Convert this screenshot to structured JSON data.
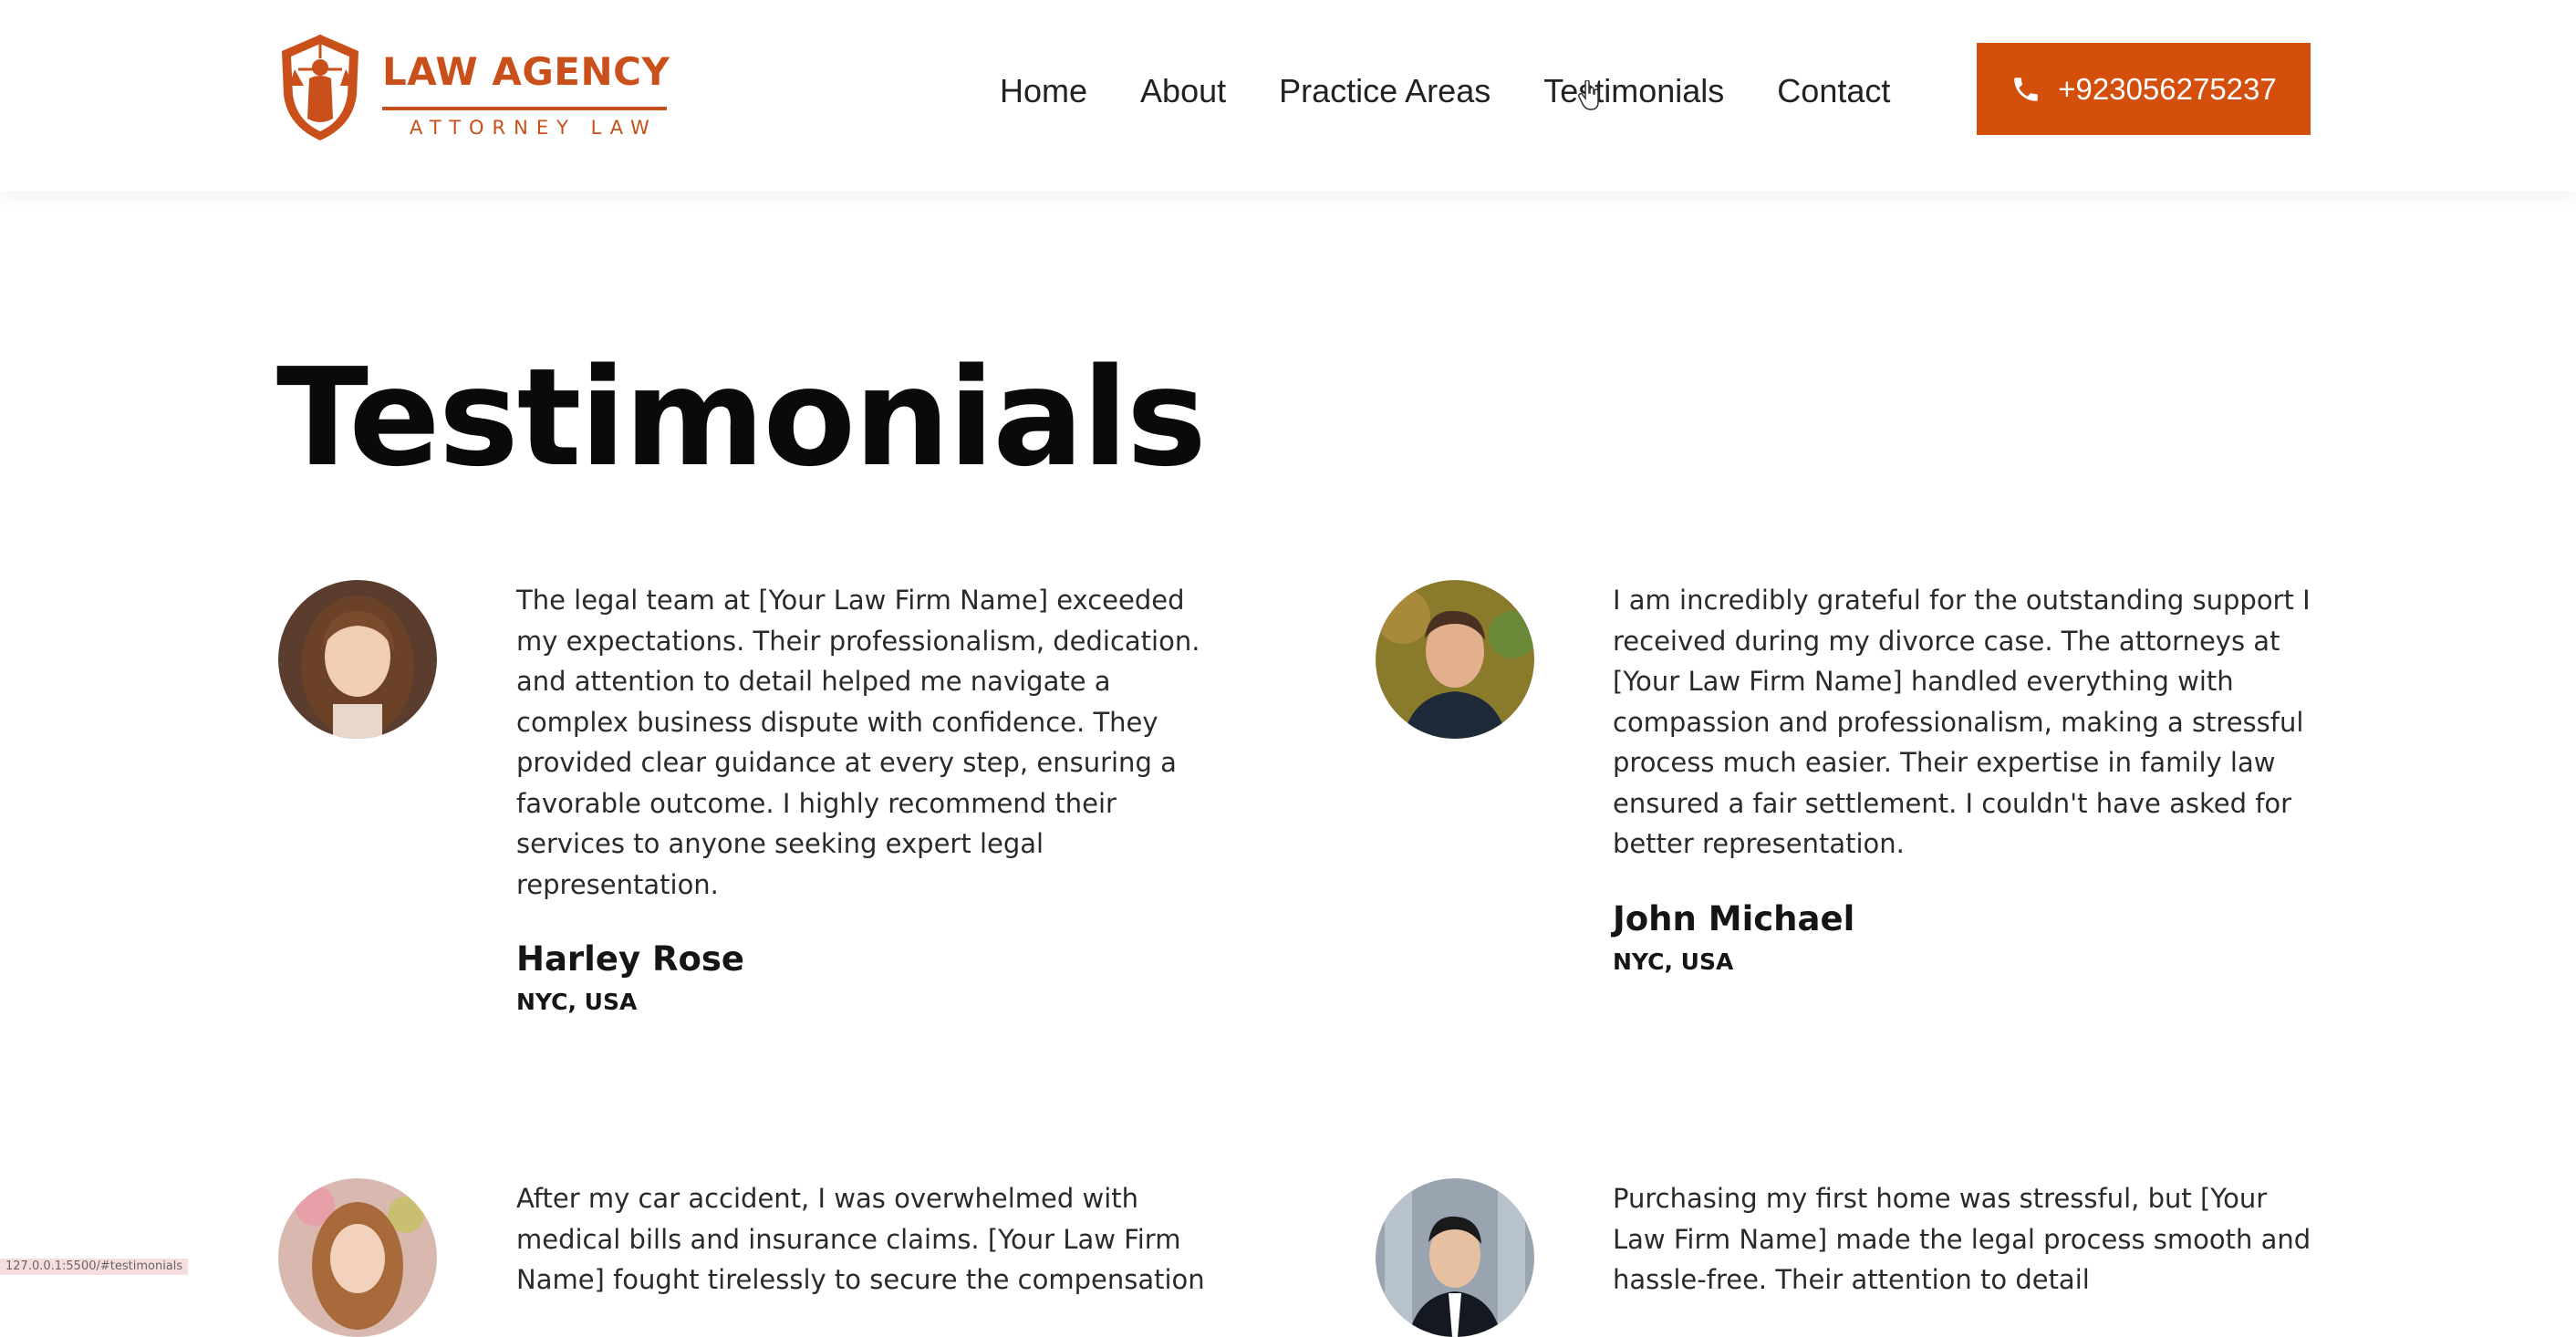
{
  "brand": {
    "title": "LAW AGENCY",
    "subtitle": "ATTORNEY LAW"
  },
  "colors": {
    "accent": "#d44f0c",
    "brand": "#c9501a"
  },
  "nav": {
    "items": [
      {
        "label": "Home"
      },
      {
        "label": "About"
      },
      {
        "label": "Practice Areas"
      },
      {
        "label": "Testimonials"
      },
      {
        "label": "Contact"
      }
    ]
  },
  "phone": {
    "icon": "phone-icon",
    "number": "+923056275237"
  },
  "page": {
    "title": "Testimonials"
  },
  "testimonials": [
    {
      "quote": "The legal team at [Your Law Firm Name] exceeded my expectations. Their professionalism, dedication. and attention to detail helped me navigate a complex business dispute with confidence. They provided clear guidance at every step, ensuring a favorable outcome. I highly recommend their services to anyone seeking expert legal representation.",
      "name": "Harley Rose",
      "location": "NYC, USA"
    },
    {
      "quote": "I am incredibly grateful for the outstanding support I received during my divorce case. The attorneys at [Your Law Firm Name] handled everything with compassion and professionalism, making a stressful process much easier. Their expertise in family law ensured a fair settlement. I couldn't have asked for better representation.",
      "name": "John Michael",
      "location": "NYC, USA"
    },
    {
      "quote": "After my car accident, I was overwhelmed with medical bills and insurance claims. [Your Law Firm Name] fought tirelessly to secure the compensation"
    },
    {
      "quote": "Purchasing my first home was stressful, but [Your Law Firm Name] made the legal process smooth and hassle-free. Their attention to detail"
    }
  ],
  "status_bar": {
    "url": "127.0.0.1:5500/#testimonials"
  }
}
